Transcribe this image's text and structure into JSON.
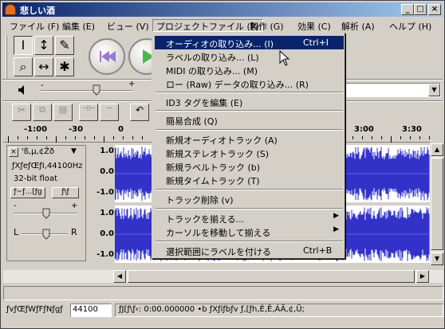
{
  "window": {
    "title": "悲しい酒"
  },
  "menubar": {
    "items": [
      "ファイル (F)",
      "編集 (E)",
      "ビュー (V)",
      "プロジェクトファイル (P)",
      "製作 (G)",
      "効果 (C)",
      "解析 (A)",
      "ヘルプ (H)"
    ]
  },
  "dropdown": {
    "items": [
      {
        "label": "オーディオの取り込み... (I)",
        "shortcut": "Ctrl+I"
      },
      {
        "label": "ラベルの取り込み... (L)"
      },
      {
        "label": "MIDI の取り込み... (M)"
      },
      {
        "label": "ロー (Raw) データの取り込み... (R)"
      },
      {
        "label": "ID3 タグを編集 (E)"
      },
      {
        "label": "簡易合成 (Q)"
      },
      {
        "label": "新規オーディオトラック (A)"
      },
      {
        "label": "新規ステレオトラック (S)"
      },
      {
        "label": "新規ラベルトラック (b)"
      },
      {
        "label": "新規タイムトラック (T)"
      },
      {
        "label": "トラック削除 (v)"
      },
      {
        "label": "トラックを揃える..."
      },
      {
        "label": "カーソルを移動して揃える"
      },
      {
        "label": "選択範囲にラベルを付ける",
        "shortcut": "Ctrl+B"
      }
    ]
  },
  "ruler": {
    "labels": [
      "-1:00",
      "-30",
      "0",
      "3:00",
      "3:30"
    ]
  },
  "track": {
    "name": "'ß,µ,¢Žð",
    "info1": "ƒXƒeƒŒƒI,44100Hz",
    "info2": "32-bit float",
    "btn_mute": "ƒ~ƒ…[ƒg",
    "btn_solo": "ƒ\\ƒ",
    "pan_left": "L",
    "pan_right": "R",
    "gain_minus": "-",
    "gain_plus": "+",
    "scale": [
      "1.0",
      "0.0",
      "-1.0",
      "1.0",
      "0.0",
      "-1.0"
    ]
  },
  "status": {
    "rate": "ƒvƒŒƒWƒFƒNƒgƒ",
    "rate_value": "44100",
    "selection": "ƒJ[ƒ\\ƒ‹: 0:00.000000 •b   ƒXƒiƒbƒv ƒ‚[ƒh,É,Ê,ÁÄ,¢,Ü;"
  },
  "colors": {
    "waveform": "#3232c8",
    "highlight": "#0a246a"
  }
}
